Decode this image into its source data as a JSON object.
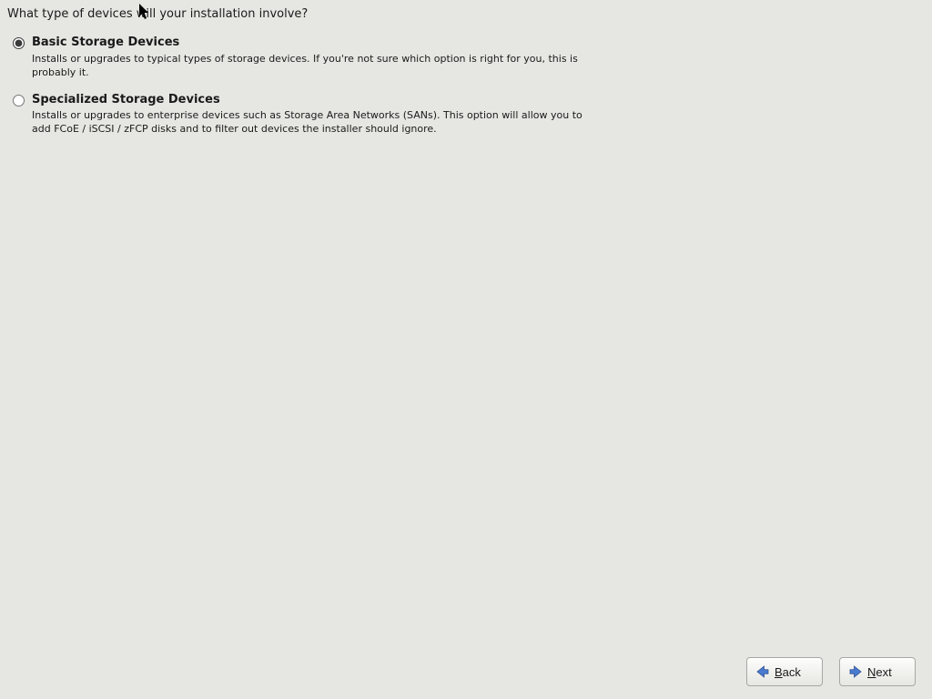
{
  "header": {
    "question": "What type of devices will your installation involve?"
  },
  "options": [
    {
      "title": "Basic Storage Devices",
      "description": "Installs or upgrades to typical types of storage devices.  If you're not sure which option is right for you, this is probably it.",
      "selected": true
    },
    {
      "title": "Specialized Storage Devices",
      "description": "Installs or upgrades to enterprise devices such as Storage Area Networks (SANs). This option will allow you to add FCoE / iSCSI / zFCP disks and to filter out devices the installer should ignore.",
      "selected": false
    }
  ],
  "footer": {
    "back_mnemonic": "B",
    "back_rest": "ack",
    "next_mnemonic": "N",
    "next_rest": "ext"
  }
}
